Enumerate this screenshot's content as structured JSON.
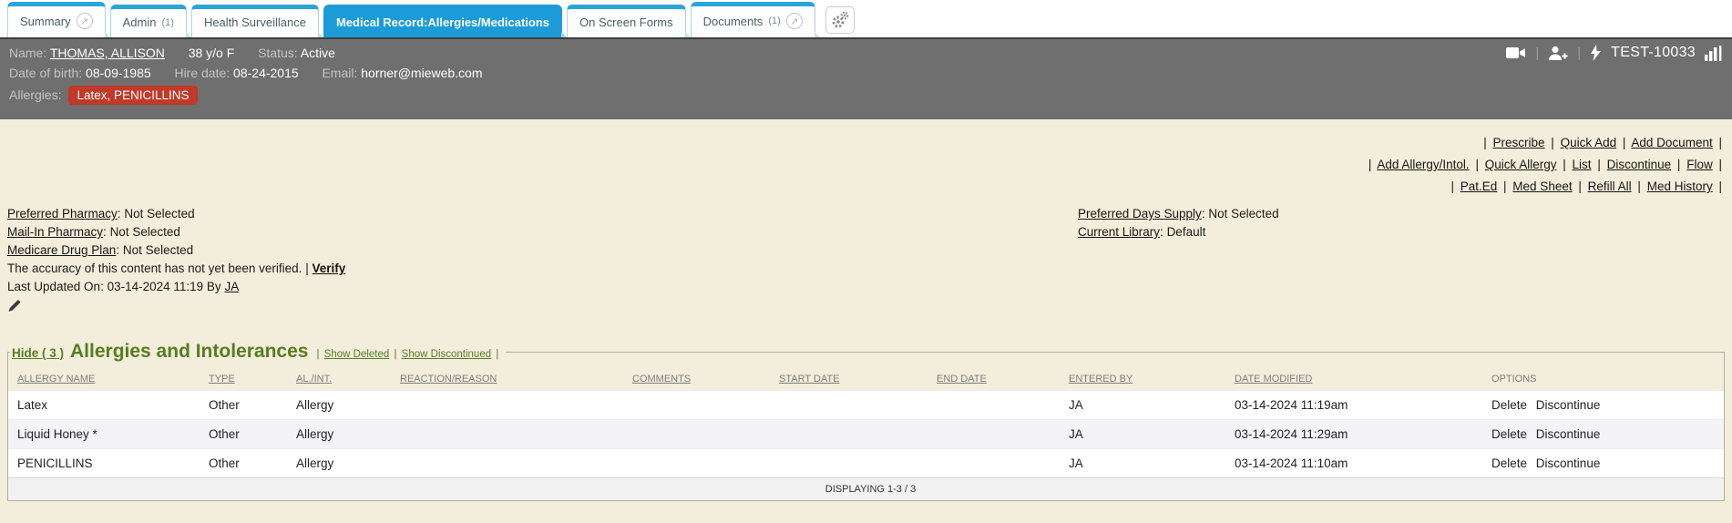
{
  "ui": {
    "pipe": "|",
    "colon": ":"
  },
  "icons": {
    "popout": "↗"
  },
  "tab_bar": {
    "tabs": [
      {
        "label": "Summary",
        "count": ""
      },
      {
        "label": "Admin",
        "count": "(1)"
      },
      {
        "label": "Health Surveillance",
        "count": ""
      },
      {
        "label": "Medical Record:Allergies/Medications",
        "count": ""
      },
      {
        "label": "On Screen Forms",
        "count": ""
      },
      {
        "label": "Documents",
        "count": "(1)"
      }
    ]
  },
  "patient_header": {
    "name_label": "Name:",
    "name": "THOMAS, ALLISON",
    "age_sex": "38 y/o F",
    "status_label": "Status:",
    "status": "Active",
    "patient_id": "TEST-10033",
    "dob_label": "Date of birth:",
    "dob": "08-09-1985",
    "hire_label": "Hire date:",
    "hire_date": "08-24-2015",
    "email_label": "Email:",
    "email": "horner@mieweb.com",
    "allergies_label": "Allergies:",
    "allergies_badge": "Latex, PENICILLINS",
    "badge_color": "#c13928"
  },
  "action_links": {
    "row1": [
      "Prescribe",
      "Quick Add",
      "Add Document"
    ],
    "row2": [
      "Add Allergy/Intol.",
      "Quick Allergy",
      "List",
      "Discontinue",
      "Flow"
    ],
    "row3": [
      "Pat.Ed",
      "Med Sheet",
      "Refill All",
      "Med History"
    ]
  },
  "pharmacy_info": {
    "items": [
      {
        "label": "Preferred Pharmacy",
        "value": "Not Selected"
      },
      {
        "label": "Mail-In Pharmacy",
        "value": "Not Selected"
      },
      {
        "label": "Medicare Drug Plan",
        "value": "Not Selected"
      }
    ],
    "verify_notice": "The accuracy of this content has not yet been verified.",
    "verify_link": "Verify",
    "last_updated_text": "Last Updated On: 03-14-2024 11:19 By",
    "last_updated_by": "JA"
  },
  "supply_info": {
    "items": [
      {
        "label": "Preferred Days Supply",
        "value": "Not Selected"
      },
      {
        "label": "Current Library",
        "value": "Default"
      }
    ]
  },
  "allergies_section": {
    "hide_link": "Hide ( 3 )",
    "title": "Allergies and Intolerances",
    "show_deleted": "Show Deleted",
    "show_discontinued": "Show Discontinued",
    "table": {
      "headers": [
        "ALLERGY NAME",
        "TYPE",
        "AL./INT.",
        "REACTION/REASON",
        "COMMENTS",
        "START DATE",
        "END DATE",
        "ENTERED BY",
        "DATE MODIFIED",
        "OPTIONS"
      ],
      "rows": [
        {
          "allergy_name": "Latex",
          "type": "Other",
          "al_int": "Allergy",
          "reaction": "",
          "comments": "",
          "start_date": "",
          "end_date": "",
          "entered_by": "JA",
          "date_modified": "03-14-2024 11:19am",
          "options": [
            "Delete",
            "Discontinue"
          ]
        },
        {
          "allergy_name": "Liquid Honey *",
          "type": "Other",
          "al_int": "Allergy",
          "reaction": "",
          "comments": "",
          "start_date": "",
          "end_date": "",
          "entered_by": "JA",
          "date_modified": "03-14-2024 11:29am",
          "options": [
            "Delete",
            "Discontinue"
          ]
        },
        {
          "allergy_name": "PENICILLINS",
          "type": "Other",
          "al_int": "Allergy",
          "reaction": "",
          "comments": "",
          "start_date": "",
          "end_date": "",
          "entered_by": "JA",
          "date_modified": "03-14-2024 11:10am",
          "options": [
            "Delete",
            "Discontinue"
          ]
        }
      ],
      "footer": "DISPLAYING 1-3 / 3"
    }
  }
}
